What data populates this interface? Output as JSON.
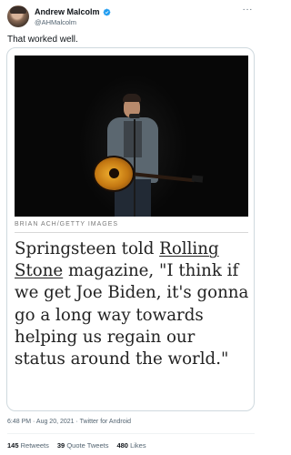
{
  "author": {
    "display_name": "Andrew Malcolm",
    "handle": "@AHMalcolm"
  },
  "tweet": {
    "text": "That worked well.",
    "more_icon": "···"
  },
  "media": {
    "photo_icon": "photo-image",
    "credit": "BRIAN ACH/GETTY IMAGES",
    "quote_lines": [
      [
        "Springsteen told ",
        "Rolling",
        ""
      ],
      [
        "",
        "Stone",
        " magazine, \"I think if"
      ],
      [
        "we get Joe Biden, it's gonna",
        "",
        ""
      ],
      [
        "go a long way towards",
        "",
        ""
      ],
      [
        "helping us regain our",
        "",
        ""
      ],
      [
        "status around the world.\"",
        "",
        ""
      ]
    ]
  },
  "meta": {
    "timestamp": "6:48 PM · Aug 20, 2021 · Twitter for Android"
  },
  "stats": {
    "retweets_count": "145",
    "retweets_label": "Retweets",
    "quote_count": "39",
    "quote_label": "Quote Tweets",
    "likes_count": "480",
    "likes_label": "Likes"
  },
  "colors": {
    "verified": "#1d9bf0",
    "text": "#0f1419",
    "secondary": "#536471"
  }
}
